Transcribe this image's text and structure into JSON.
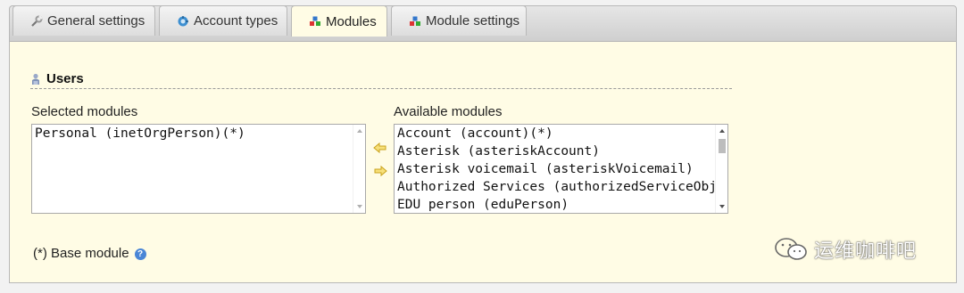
{
  "tabs": [
    {
      "label": "General settings",
      "icon": "wrench-icon",
      "active": false
    },
    {
      "label": "Account types",
      "icon": "account-types-icon",
      "active": false
    },
    {
      "label": "Modules",
      "icon": "modules-icon",
      "active": true
    },
    {
      "label": "Module settings",
      "icon": "module-settings-icon",
      "active": false
    }
  ],
  "section": {
    "title": "Users",
    "icon": "user-icon"
  },
  "selected": {
    "label": "Selected modules",
    "items": [
      "Personal (inetOrgPerson)(*)"
    ]
  },
  "available": {
    "label": "Available modules",
    "items": [
      "Account (account)(*)",
      "Asterisk (asteriskAccount)",
      "Asterisk voicemail (asteriskVoicemail)",
      "Authorized Services (authorizedServiceObject)",
      "EDU person (eduPerson)"
    ]
  },
  "footer": {
    "base_module_note": "(*) Base module"
  },
  "watermark": {
    "text": "运维咖啡吧"
  },
  "colors": {
    "panel_bg": "#fffce5",
    "arrow": "#e8c234",
    "help": "#4a86d6"
  }
}
